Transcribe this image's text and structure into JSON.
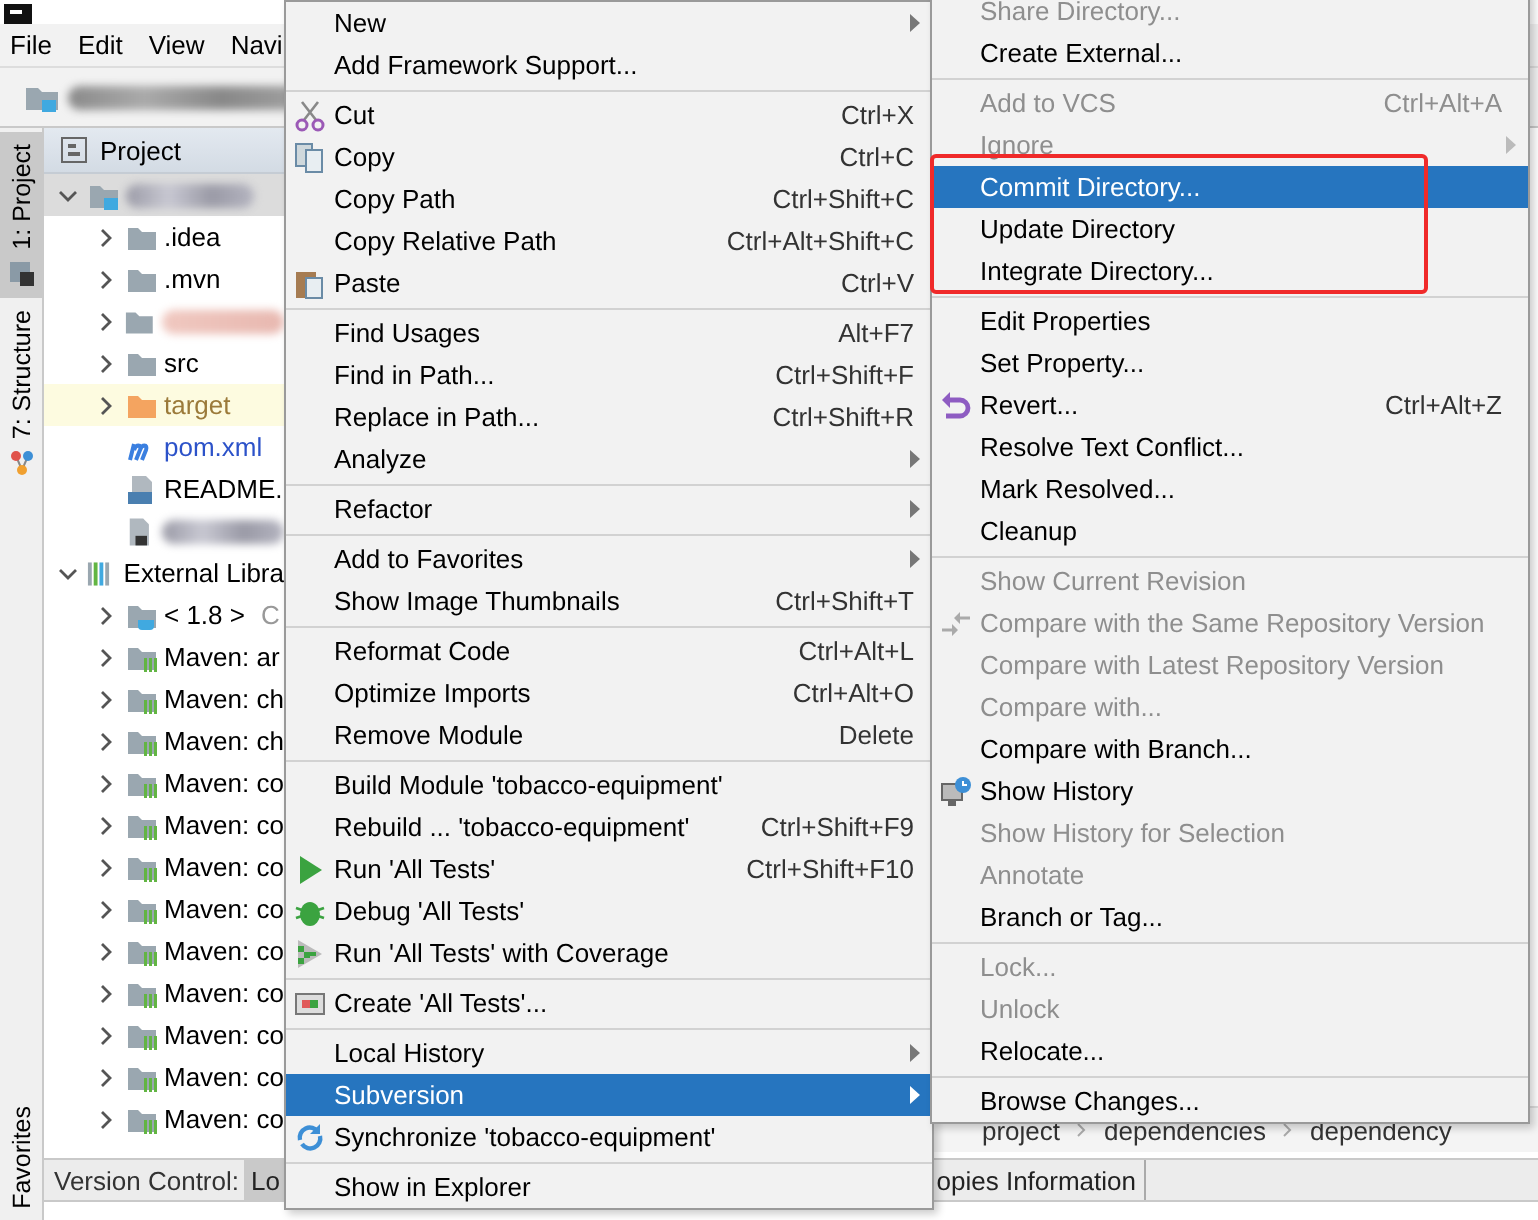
{
  "menubar": {
    "items": [
      "File",
      "Edit",
      "View",
      "Navi"
    ]
  },
  "tool_strip": {
    "tabs": [
      {
        "label": "1: Project",
        "selected": true
      },
      {
        "label": "7: Structure",
        "selected": false
      }
    ],
    "bottom_tabs": [
      {
        "label": "Favorites",
        "selected": false
      }
    ]
  },
  "project_panel": {
    "title": "Project",
    "tree": [
      {
        "kind": "module",
        "blurred": true,
        "expanded": true,
        "selected": true,
        "children": [
          {
            "kind": "folder",
            "label": ".idea",
            "expanded": false,
            "selected": false,
            "color": "#000000"
          },
          {
            "kind": "folder",
            "label": ".mvn",
            "expanded": false,
            "selected": false,
            "color": "#000000"
          },
          {
            "kind": "folder",
            "blurred": true,
            "expanded": false,
            "selected": false
          },
          {
            "kind": "folder",
            "label": "src",
            "expanded": false,
            "selected": false,
            "color": "#000000"
          },
          {
            "kind": "excluded",
            "label": "target",
            "expanded": false,
            "selected": false,
            "color": "#9b7a3a"
          },
          {
            "kind": "maven",
            "label": "pom.xml",
            "selected": false,
            "color": "#2c52c9"
          },
          {
            "kind": "markdown",
            "label": "README.",
            "selected": false,
            "color": "#000000"
          },
          {
            "kind": "file",
            "blurred": true,
            "selected": false
          }
        ]
      },
      {
        "kind": "libraries",
        "label": "External Libra",
        "expanded": true,
        "selected": false,
        "children": [
          {
            "kind": "jdk",
            "label": "< 1.8 >",
            "hint": "C",
            "expanded": false,
            "selected": false,
            "color": "#000000"
          },
          {
            "kind": "library",
            "label": "Maven: ar",
            "expanded": false,
            "selected": false,
            "color": "#000000"
          },
          {
            "kind": "library",
            "label": "Maven: ch",
            "expanded": false,
            "selected": false,
            "color": "#000000"
          },
          {
            "kind": "library",
            "label": "Maven: ch",
            "expanded": false,
            "selected": false,
            "color": "#000000"
          },
          {
            "kind": "library",
            "label": "Maven: co",
            "expanded": false,
            "selected": false,
            "color": "#000000"
          },
          {
            "kind": "library",
            "label": "Maven: co",
            "expanded": false,
            "selected": false,
            "color": "#000000"
          },
          {
            "kind": "library",
            "label": "Maven: co",
            "expanded": false,
            "selected": false,
            "color": "#000000"
          },
          {
            "kind": "library",
            "label": "Maven: co",
            "expanded": false,
            "selected": false,
            "color": "#000000"
          },
          {
            "kind": "library",
            "label": "Maven: co",
            "expanded": false,
            "selected": false,
            "color": "#000000"
          },
          {
            "kind": "library",
            "label": "Maven: co",
            "expanded": false,
            "selected": false,
            "color": "#000000"
          },
          {
            "kind": "library",
            "label": "Maven: co",
            "expanded": false,
            "selected": false,
            "color": "#000000"
          },
          {
            "kind": "library",
            "label": "Maven: co",
            "expanded": false,
            "selected": false,
            "color": "#000000"
          },
          {
            "kind": "library",
            "label": "Maven: co",
            "expanded": false,
            "selected": false,
            "color": "#000000"
          }
        ]
      }
    ]
  },
  "editor": {
    "breadcrumbs": [
      "project",
      "dependencies",
      "dependency"
    ]
  },
  "bottom_bar": {
    "title": "Version Control:",
    "tabs": [
      {
        "label": "Lo",
        "selected": true
      },
      {
        "label": "opies Information",
        "selected": false
      }
    ]
  },
  "context_menu": {
    "groups": [
      {
        "items": [
          {
            "label": "New",
            "kind": "submenu",
            "selected": false
          },
          {
            "label": "Add Framework Support...",
            "kind": "action",
            "selected": false
          }
        ]
      },
      {
        "items": [
          {
            "label": "Cut",
            "shortcut": "Ctrl+X",
            "kind": "cut",
            "selected": false
          },
          {
            "label": "Copy",
            "shortcut": "Ctrl+C",
            "kind": "copy",
            "selected": false
          },
          {
            "label": "Copy Path",
            "shortcut": "Ctrl+Shift+C",
            "kind": "action",
            "selected": false
          },
          {
            "label": "Copy Relative Path",
            "shortcut": "Ctrl+Alt+Shift+C",
            "kind": "action",
            "selected": false
          },
          {
            "label": "Paste",
            "shortcut": "Ctrl+V",
            "kind": "paste",
            "selected": false
          }
        ]
      },
      {
        "items": [
          {
            "label": "Find Usages",
            "shortcut": "Alt+F7",
            "kind": "action",
            "selected": false
          },
          {
            "label": "Find in Path...",
            "shortcut": "Ctrl+Shift+F",
            "kind": "action",
            "selected": false
          },
          {
            "label": "Replace in Path...",
            "shortcut": "Ctrl+Shift+R",
            "kind": "action",
            "selected": false
          },
          {
            "label": "Analyze",
            "kind": "submenu",
            "selected": false
          }
        ]
      },
      {
        "items": [
          {
            "label": "Refactor",
            "kind": "submenu",
            "selected": false
          }
        ]
      },
      {
        "items": [
          {
            "label": "Add to Favorites",
            "kind": "submenu",
            "selected": false
          },
          {
            "label": "Show Image Thumbnails",
            "shortcut": "Ctrl+Shift+T",
            "kind": "action",
            "selected": false
          }
        ]
      },
      {
        "items": [
          {
            "label": "Reformat Code",
            "shortcut": "Ctrl+Alt+L",
            "kind": "action",
            "selected": false
          },
          {
            "label": "Optimize Imports",
            "shortcut": "Ctrl+Alt+O",
            "kind": "action",
            "selected": false
          },
          {
            "label": "Remove Module",
            "shortcut": "Delete",
            "kind": "action",
            "selected": false
          }
        ]
      },
      {
        "items": [
          {
            "label": "Build Module 'tobacco-equipment'",
            "kind": "action",
            "selected": false
          },
          {
            "label": "Rebuild ... 'tobacco-equipment'",
            "shortcut": "Ctrl+Shift+F9",
            "kind": "action",
            "selected": false
          },
          {
            "label": "Run 'All Tests'",
            "shortcut": "Ctrl+Shift+F10",
            "kind": "run",
            "selected": false
          },
          {
            "label": "Debug 'All Tests'",
            "kind": "debug",
            "selected": false
          },
          {
            "label": "Run 'All Tests' with Coverage",
            "kind": "coverage",
            "selected": false
          }
        ]
      },
      {
        "items": [
          {
            "label": "Create 'All Tests'...",
            "kind": "create-test",
            "selected": false
          }
        ]
      },
      {
        "items": [
          {
            "label": "Local History",
            "kind": "submenu",
            "selected": false
          },
          {
            "label": "Subversion",
            "kind": "submenu",
            "selected": true
          },
          {
            "label": "Synchronize 'tobacco-equipment'",
            "kind": "sync",
            "selected": false
          }
        ]
      },
      {
        "items": [
          {
            "label": "Show in Explorer",
            "kind": "action",
            "selected": false
          }
        ]
      }
    ]
  },
  "subversion_menu": {
    "groups": [
      {
        "separated": false,
        "framed": false,
        "items": [
          {
            "label": "Share Directory...",
            "kind": "action",
            "disabled": true,
            "selected": false
          },
          {
            "label": "Create External...",
            "kind": "action",
            "disabled": false,
            "selected": false
          }
        ]
      },
      {
        "separated": true,
        "framed": false,
        "items": [
          {
            "label": "Add to VCS",
            "shortcut": "Ctrl+Alt+A",
            "kind": "action",
            "disabled": true,
            "selected": false
          },
          {
            "label": "Ignore",
            "kind": "submenu",
            "disabled": true,
            "selected": false
          }
        ]
      },
      {
        "separated": false,
        "framed": true,
        "items": [
          {
            "label": "Commit Directory...",
            "kind": "action",
            "disabled": false,
            "selected": true
          },
          {
            "label": "Update Directory",
            "kind": "action",
            "disabled": false,
            "selected": false
          },
          {
            "label": "Integrate Directory...",
            "kind": "action",
            "disabled": false,
            "selected": false
          }
        ]
      },
      {
        "separated": true,
        "framed": false,
        "items": [
          {
            "label": "Edit Properties",
            "kind": "action",
            "disabled": false,
            "selected": false
          },
          {
            "label": "Set Property...",
            "kind": "action",
            "disabled": false,
            "selected": false
          },
          {
            "label": "Revert...",
            "shortcut": "Ctrl+Alt+Z",
            "kind": "revert",
            "disabled": false,
            "selected": false
          },
          {
            "label": "Resolve Text Conflict...",
            "kind": "action",
            "disabled": false,
            "selected": false
          },
          {
            "label": "Mark Resolved...",
            "kind": "action",
            "disabled": false,
            "selected": false
          },
          {
            "label": "Cleanup",
            "kind": "action",
            "disabled": false,
            "selected": false
          }
        ]
      },
      {
        "separated": true,
        "framed": false,
        "items": [
          {
            "label": "Show Current Revision",
            "kind": "action",
            "disabled": true,
            "selected": false
          },
          {
            "label": "Compare with the Same Repository Version",
            "kind": "compare",
            "disabled": true,
            "selected": false
          },
          {
            "label": "Compare with Latest Repository Version",
            "kind": "action",
            "disabled": true,
            "selected": false
          },
          {
            "label": "Compare with...",
            "kind": "action",
            "disabled": true,
            "selected": false
          },
          {
            "label": "Compare with Branch...",
            "kind": "action",
            "disabled": false,
            "selected": false
          },
          {
            "label": "Show History",
            "kind": "history",
            "disabled": false,
            "selected": false
          },
          {
            "label": "Show History for Selection",
            "kind": "action",
            "disabled": true,
            "selected": false
          },
          {
            "label": "Annotate",
            "kind": "action",
            "disabled": true,
            "selected": false
          },
          {
            "label": "Branch or Tag...",
            "kind": "action",
            "disabled": false,
            "selected": false
          }
        ]
      },
      {
        "separated": true,
        "framed": false,
        "items": [
          {
            "label": "Lock...",
            "kind": "action",
            "disabled": true,
            "selected": false
          },
          {
            "label": "Unlock",
            "kind": "action",
            "disabled": true,
            "selected": false
          },
          {
            "label": "Relocate...",
            "kind": "action",
            "disabled": false,
            "selected": false
          }
        ]
      },
      {
        "separated": true,
        "framed": false,
        "items": [
          {
            "label": "Browse Changes...",
            "kind": "action",
            "disabled": false,
            "selected": false
          }
        ]
      }
    ]
  }
}
